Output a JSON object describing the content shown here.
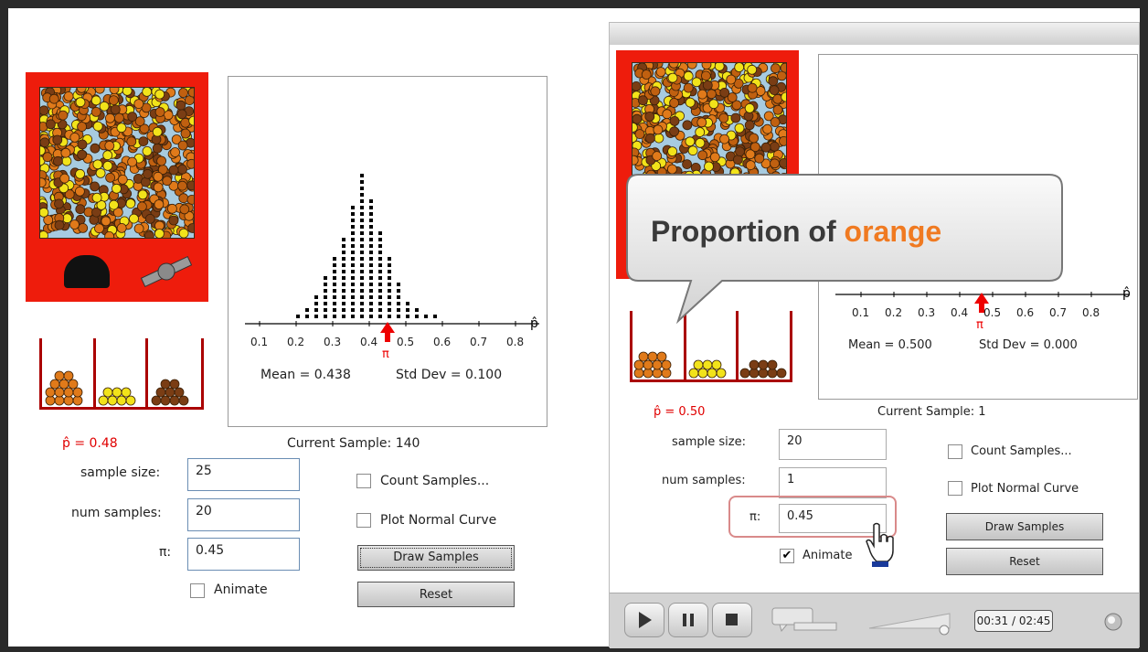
{
  "left": {
    "p_hat_label": "p̂ = 0.48",
    "current_sample": "Current Sample: 140",
    "mean": "Mean = 0.438",
    "std": "Std Dev = 0.100",
    "pi_marker": "π",
    "axis_ticks": [
      "0.1",
      "0.2",
      "0.3",
      "0.4",
      "0.5",
      "0.6",
      "0.7",
      "0.8"
    ],
    "axis_symbol": "p̂",
    "fields": {
      "sample_size_label": "sample size:",
      "sample_size_value": "25",
      "num_samples_label": "num samples:",
      "num_samples_value": "20",
      "pi_label": "π:",
      "pi_value": "0.45"
    },
    "count_samples": "Count Samples...",
    "plot_normal": "Plot Normal Curve",
    "draw_samples": "Draw Samples",
    "reset": "Reset",
    "animate": "Animate",
    "histogram_counts": [
      1,
      2,
      4,
      7,
      10,
      13,
      18,
      23,
      19,
      14,
      10,
      6,
      3,
      2,
      1,
      1
    ]
  },
  "right": {
    "p_hat_label": "p̂ = 0.50",
    "current_sample": "Current Sample: 1",
    "mean": "Mean = 0.500",
    "std": "Std Dev = 0.000",
    "pi_marker": "π",
    "axis_ticks": [
      "0.1",
      "0.2",
      "0.3",
      "0.4",
      "0.5",
      "0.6",
      "0.7",
      "0.8"
    ],
    "axis_symbol": "p̂",
    "fields": {
      "sample_size_label": "sample size:",
      "sample_size_value": "20",
      "num_samples_label": "num samples:",
      "num_samples_value": "1",
      "pi_label": "π:",
      "pi_value": "0.45"
    },
    "count_samples": "Count Samples...",
    "plot_normal": "Plot Normal Curve",
    "draw_samples": "Draw Samples",
    "reset": "Reset",
    "animate": "Animate",
    "callout_text_1": "Proportion of ",
    "callout_text_2": "orange",
    "player": {
      "time": "00:31 / 02:45"
    }
  },
  "colors": {
    "machine_red": "#ee1c0c",
    "orange_candy": "#e07a1a",
    "yellow_candy": "#f2e31a",
    "brown_candy": "#7a3d14",
    "callout_orange": "#f07a21"
  }
}
